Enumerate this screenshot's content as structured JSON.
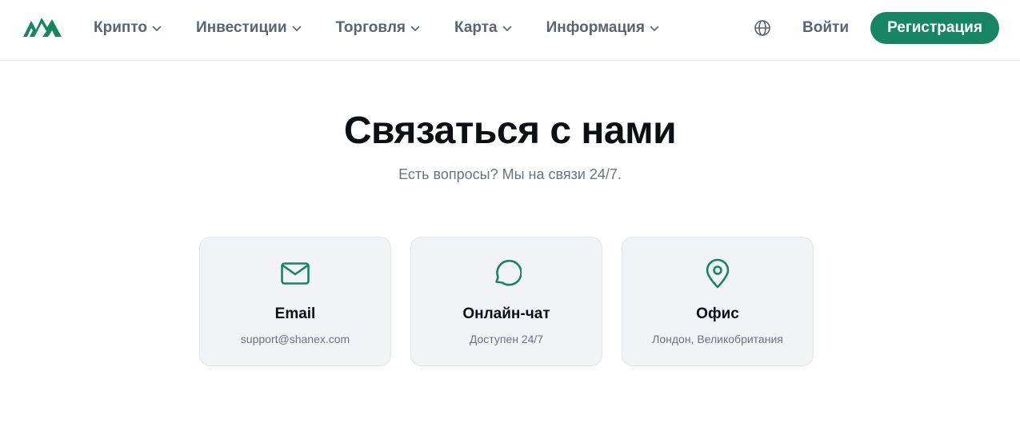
{
  "brand": {
    "logo_icon": "mountains-logo-icon",
    "accent_color": "#168562"
  },
  "nav": {
    "items": [
      {
        "label": "Крипто",
        "icon": "chevron-down-icon"
      },
      {
        "label": "Инвестиции",
        "icon": "chevron-down-icon"
      },
      {
        "label": "Торговля",
        "icon": "chevron-down-icon"
      },
      {
        "label": "Карта",
        "icon": "chevron-down-icon"
      },
      {
        "label": "Информация",
        "icon": "chevron-down-icon"
      }
    ],
    "language_icon": "globe-icon",
    "login_label": "Войти",
    "register_label": "Регистрация"
  },
  "hero": {
    "title": "Связаться с нами",
    "subtitle": "Есть вопросы? Мы на связи 24/7."
  },
  "contacts": [
    {
      "icon": "mail-icon",
      "title": "Email",
      "text": "support@shanex.com"
    },
    {
      "icon": "chat-bubble-icon",
      "title": "Онлайн-чат",
      "text": "Доступен 24/7"
    },
    {
      "icon": "map-pin-icon",
      "title": "Офис",
      "text": "Лондон, Великобритания"
    }
  ]
}
